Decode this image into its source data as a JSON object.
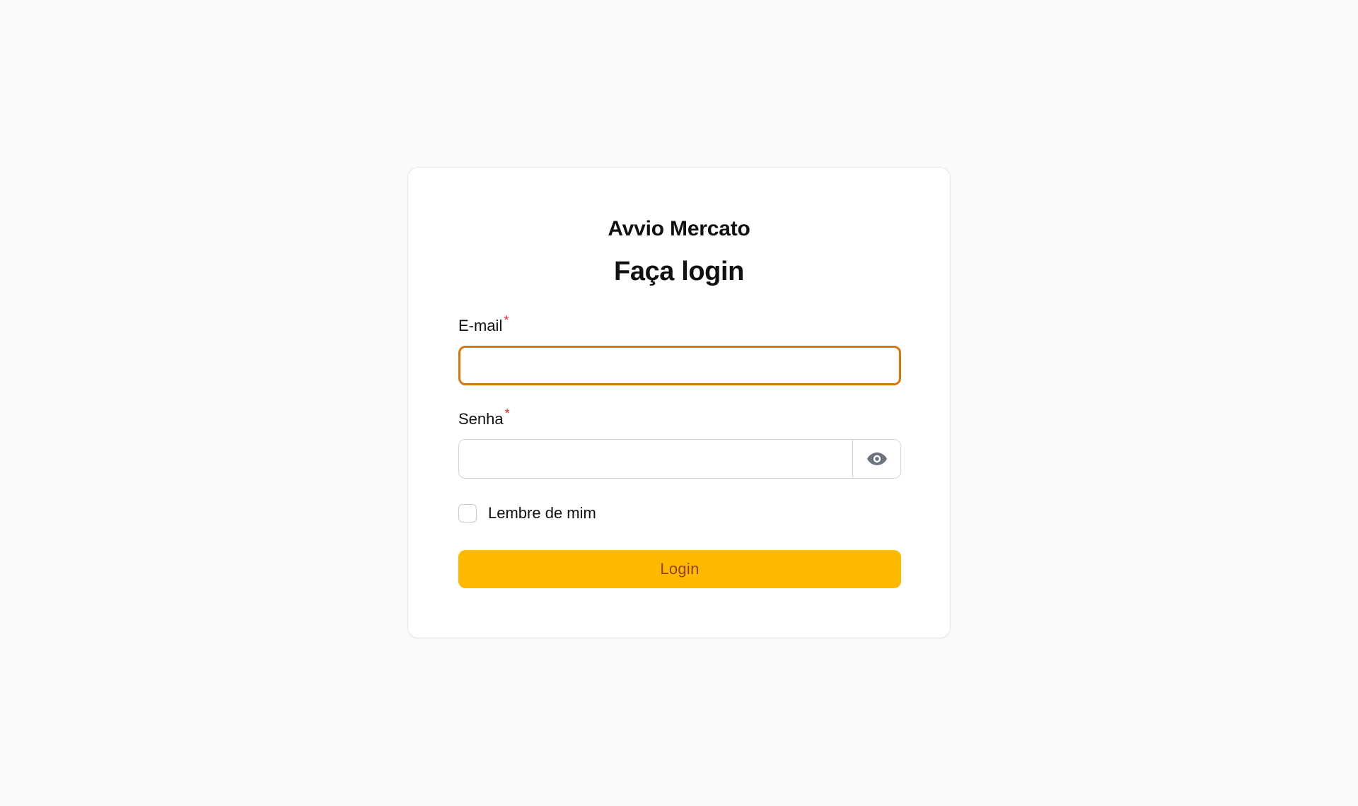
{
  "app": {
    "brand": "Avvio Mercato",
    "heading": "Faça login"
  },
  "form": {
    "email": {
      "label": "E-mail",
      "required_mark": "*",
      "value": "",
      "placeholder": ""
    },
    "password": {
      "label": "Senha",
      "required_mark": "*",
      "value": "",
      "placeholder": "",
      "toggle_icon": "eye-icon"
    },
    "remember": {
      "label": "Lembre de mim",
      "checked": false
    },
    "submit_label": "Login"
  },
  "colors": {
    "page_background": "#fafafa",
    "card_background": "#ffffff",
    "accent": "#ffba00",
    "accent_text": "#92400e",
    "focus_border": "#d97706",
    "required": "#dc2626"
  }
}
